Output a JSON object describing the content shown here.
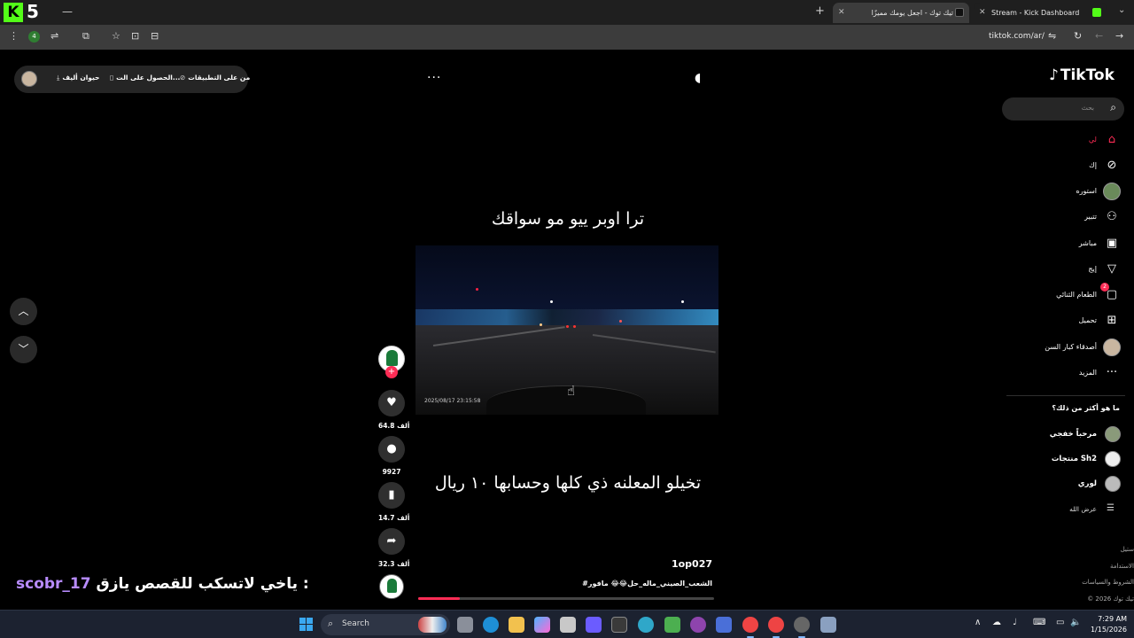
{
  "browser": {
    "corner_label": "5",
    "tabs": [
      {
        "title": "تيك توك - اجعل يومك مميزًا",
        "active": true
      },
      {
        "title": "Stream - Kick Dashboard",
        "active": false
      }
    ],
    "url": "tiktok.com/ar/",
    "extension_badge": "4"
  },
  "player_actions": {
    "live_label": "حيوان أليف",
    "get_app_label": "الحصول على الت...",
    "apps_label": "من على التطبيقات"
  },
  "video": {
    "caption_top": "ترا اوبر ييو مو سواقك",
    "caption_bottom": "تخيلو المعلنه ذي كلها وحسابها ١٠ ريال",
    "timestamp": "2025/08/17  23:15:58",
    "author": "1op027",
    "hashtags": "#الشعب_الصيني_ماله_حل😂😂 مافور",
    "progress": 0.14
  },
  "rail": {
    "likes": "64.8 ألف",
    "comments": "9927",
    "saves": "14.7 ألف",
    "shares": "32.3 ألف"
  },
  "sidebar": {
    "logo": "TikTok",
    "search_placeholder": "بحث",
    "nav": [
      {
        "label": "لي",
        "icon": "home-icon",
        "glyph": "⌂"
      },
      {
        "label": "إك",
        "icon": "compass-icon",
        "glyph": "⊘"
      },
      {
        "label": "استوره",
        "icon": "avatar-icon",
        "glyph": ""
      },
      {
        "label": "تتبير",
        "icon": "following-icon",
        "glyph": "⚇"
      },
      {
        "label": "مباشر",
        "icon": "live-icon",
        "glyph": "▣"
      },
      {
        "label": "إيج",
        "icon": "filter-icon",
        "glyph": "▽"
      },
      {
        "label": "الطعام الثنائي",
        "icon": "messages-icon",
        "glyph": "▢"
      },
      {
        "label": "تحميل",
        "icon": "upload-icon",
        "glyph": "⊞"
      },
      {
        "label": "أصدقاء كبار السن",
        "icon": "profile-avatar-icon",
        "glyph": ""
      },
      {
        "label": "المزيد",
        "icon": "more-icon",
        "glyph": "···"
      }
    ],
    "message_badge": "2",
    "following_title": "ما هو أكثر من ذلك؟",
    "accounts": [
      {
        "name": "مرحباً خفجي"
      },
      {
        "name": "منتجات Sh2"
      },
      {
        "name": "لوري"
      }
    ],
    "show_all": "عرض الله",
    "footer": [
      "ستيل",
      "الاستدامة",
      "الشروط والسياسات",
      "© 2026 تيك توك"
    ]
  },
  "stream_chat": {
    "user": "scobr_17",
    "message": "ياخي لاتسكب للقصص يازق :"
  },
  "taskbar": {
    "search_label": "Search",
    "time": "7:29 AM",
    "date": "1/15/2026"
  },
  "colors": {
    "accent": "#fe2c55",
    "kick_green": "#53fc18",
    "chat_user": "#b88cff"
  }
}
